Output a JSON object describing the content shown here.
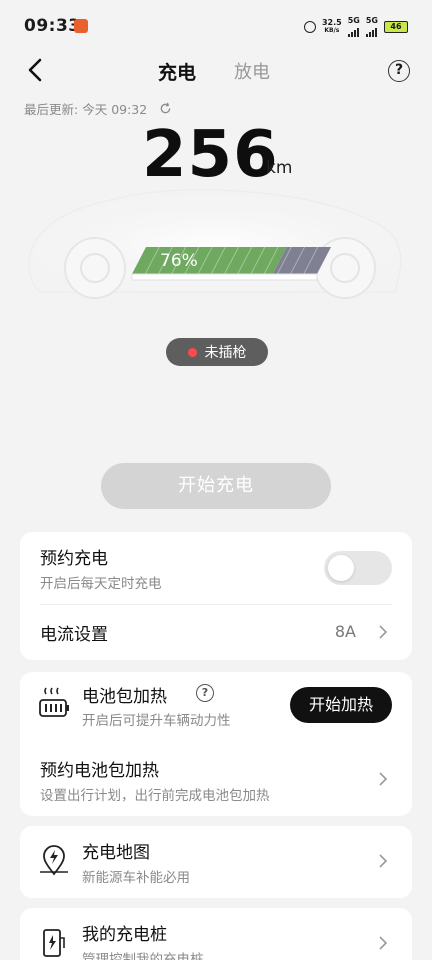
{
  "status_bar": {
    "time": "09:33",
    "net_speed_top": "32.5",
    "net_speed_bottom": "KB/s",
    "sig1_label": "5G",
    "sig2_label": "5G",
    "battery": "46"
  },
  "nav": {
    "tab_charge": "充电",
    "tab_discharge": "放电",
    "help_glyph": "?"
  },
  "last_update": {
    "label": "最后更新:",
    "value": "今天 09:32"
  },
  "range": {
    "value": "256",
    "unit": "km"
  },
  "battery": {
    "percent_label": "76%",
    "level": 0.76,
    "colors": {
      "charged": "#6fa960",
      "empty": "#7f8193"
    }
  },
  "plug_status": {
    "label": "未插枪",
    "dot_color": "#ff4a4a"
  },
  "start_charge": {
    "label": "开始充电"
  },
  "schedule_charge": {
    "title": "预约充电",
    "subtitle": "开启后每天定时充电",
    "enabled": false
  },
  "current_setting": {
    "title": "电流设置",
    "value": "8A"
  },
  "battery_heat": {
    "title": "电池包加热",
    "subtitle": "开启后可提升车辆动力性",
    "button": "开始加热",
    "help_glyph": "?"
  },
  "schedule_heat": {
    "title": "预约电池包加热",
    "subtitle": "设置出行计划，出行前完成电池包加热"
  },
  "charge_map": {
    "title": "充电地图",
    "subtitle": "新能源车补能必用",
    "icon": "map-pin-bolt-icon"
  },
  "my_charger": {
    "title": "我的充电桩",
    "subtitle": "管理控制我的充电桩",
    "icon": "charging-pile-icon"
  }
}
